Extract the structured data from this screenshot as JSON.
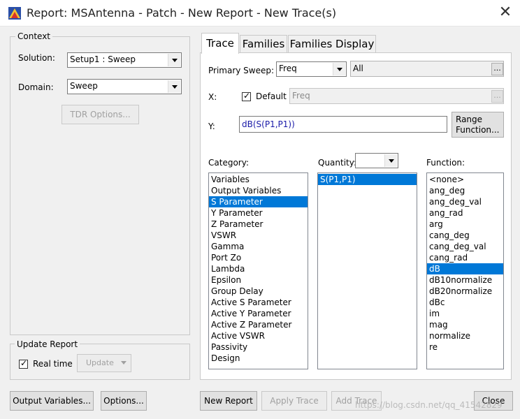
{
  "window": {
    "title": "Report: MSAntenna - Patch - New Report - New Trace(s)"
  },
  "context": {
    "label": "Context",
    "solution_label": "Solution:",
    "solution_value": "Setup1 : Sweep",
    "domain_label": "Domain:",
    "domain_value": "Sweep",
    "tdr_button": "TDR Options..."
  },
  "update_report": {
    "label": "Update Report",
    "realtime_label": "Real time",
    "realtime_checked": true,
    "update_button": "Update"
  },
  "buttons": {
    "output_variables": "Output Variables...",
    "options": "Options...",
    "new_report": "New Report",
    "apply_trace": "Apply Trace",
    "add_trace": "Add Trace",
    "close": "Close"
  },
  "tabs": [
    "Trace",
    "Families",
    "Families Display"
  ],
  "trace": {
    "primary_sweep_label": "Primary Sweep:",
    "primary_sweep_value": "Freq",
    "primary_sweep_range": "All",
    "x_label": "X:",
    "default_label": "Default",
    "default_checked": true,
    "x_value": "Freq",
    "y_label": "Y:",
    "y_value": "dB(S(P1,P1))",
    "range_function_button": "Range\nFunction...",
    "category_label": "Category:",
    "quantity_label": "Quantity:",
    "quantity_filter": "",
    "function_label": "Function:"
  },
  "categories": [
    "Variables",
    "Output Variables",
    "S Parameter",
    "Y Parameter",
    "Z Parameter",
    "VSWR",
    "Gamma",
    "Port Zo",
    "Lambda",
    "Epsilon",
    "Group Delay",
    "Active S Parameter",
    "Active Y Parameter",
    "Active Z Parameter",
    "Active VSWR",
    "Passivity",
    "Design"
  ],
  "selected_category": "S Parameter",
  "quantities": [
    "S(P1,P1)"
  ],
  "selected_quantity": "S(P1,P1)",
  "functions": [
    "<none>",
    "ang_deg",
    "ang_deg_val",
    "ang_rad",
    "arg",
    "cang_deg",
    "cang_deg_val",
    "cang_rad",
    "dB",
    "dB10normalize",
    "dB20normalize",
    "dBc",
    "im",
    "mag",
    "normalize",
    "re"
  ],
  "selected_function": "dB",
  "watermark": "https://blog.csdn.net/qq_41542829"
}
